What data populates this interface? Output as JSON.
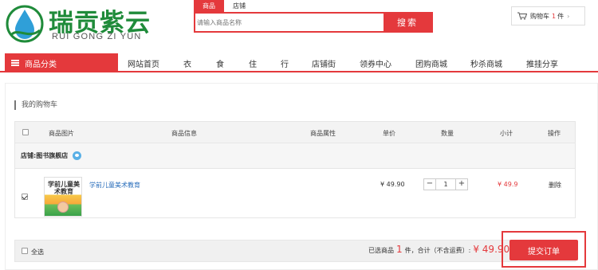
{
  "brand": {
    "name_cn": "瑞贡紫云",
    "name_en": "RUI GONG ZI YUN"
  },
  "search": {
    "tabs": [
      "商品",
      "店铺"
    ],
    "active_tab": "商品",
    "placeholder": "请输入商品名称",
    "value": "",
    "button_label": "搜索"
  },
  "cart_widget": {
    "label": "购物车",
    "count": "1",
    "unit": "件",
    "chevron": "›"
  },
  "nav": {
    "category_label": "商品分类",
    "items": [
      "网站首页",
      "衣",
      "食",
      "住",
      "行",
      "店铺街",
      "领券中心",
      "团购商城",
      "秒杀商城",
      "推挂分享"
    ]
  },
  "cart": {
    "title": "我的购物车",
    "columns": {
      "image": "商品图片",
      "info": "商品信息",
      "attr": "商品属性",
      "price": "单价",
      "qty": "数量",
      "subtotal": "小计",
      "action": "操作"
    },
    "shop": {
      "label": "店铺:",
      "name": "图书旗舰店"
    },
    "items": [
      {
        "thumbnail_text": "学前儿童美术教育",
        "title": "学前儿童美术教育",
        "price": "¥ 49.90",
        "quantity": "1",
        "subtotal": "¥ 49.9",
        "delete_label": "删除",
        "checked": true
      }
    ],
    "footer": {
      "select_all": "全选",
      "selected_prefix": "已选商品",
      "selected_count": "1",
      "selected_unit": "件，",
      "total_label": "合计（不含运费）:",
      "total_value": "¥ 49.90",
      "submit_label": "提交订单"
    }
  },
  "colors": {
    "brand_red": "#e4393c",
    "logo_green": "#1f8b3a",
    "link_blue": "#2a6ebb"
  },
  "icons": [
    "logo-drop-icon",
    "cart-icon",
    "menu-bars-icon",
    "chat-icon",
    "checkbox-icon"
  ]
}
